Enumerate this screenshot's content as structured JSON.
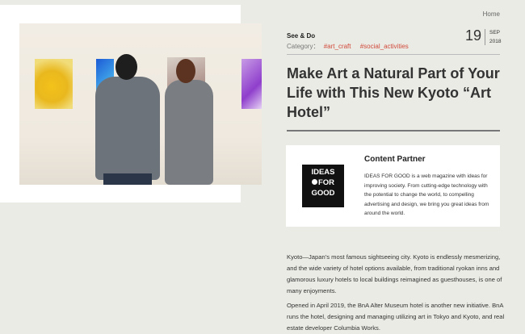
{
  "breadcrumb": "Home",
  "article": {
    "category_label": "See & Do",
    "category_prefix": "Category：",
    "tags": [
      "#art_craft",
      "#social_activities"
    ],
    "date": {
      "day": "19",
      "month": "SEP",
      "year": "2018"
    },
    "title": "Make Art a Natural Part of Your Life with This New Kyoto “Art Hotel”",
    "paragraphs": [
      "Kyoto—Japan’s most famous sightseeing city. Kyoto is endlessly mesmerizing, and the wide variety of hotel options available, from traditional ryokan inns and glamorous luxury hotels to local buildings reimagined as guesthouses, is one of many enjoyments.",
      "Opened in April 2019, the BnA Alter Museum hotel is another new initiative. BnA runs the hotel, designing and managing utilizing art in Tokyo and Kyoto, and real estate developer Columbia Works."
    ]
  },
  "partner": {
    "heading": "Content Partner",
    "logo_lines": [
      "IDEAS",
      "FOR",
      "GOOD"
    ],
    "description": "IDEAS FOR GOOD is a web magazine with ideas for improving society. From cutting-edge technology with the potential to change the world, to compelling advertising and design, we bring you great ideas from around the world."
  },
  "colors": {
    "accent": "#d04a3a",
    "background": "#ebebe6"
  }
}
